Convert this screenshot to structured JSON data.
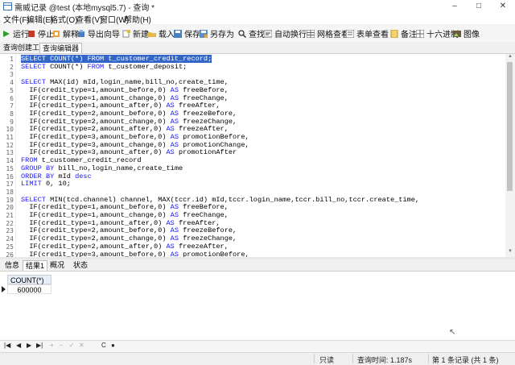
{
  "window": {
    "title": "需威记录 @test (本地mysql5.7) - 查询 *",
    "min": "–",
    "max": "□",
    "close": "✕"
  },
  "menu": [
    "文件(F)",
    "编辑(E)",
    "格式(O)",
    "查看(V)",
    "窗口(W)",
    "帮助(H)"
  ],
  "toolbar": {
    "run": "运行",
    "stop": "停止",
    "explain": "解释",
    "export": "导出向导",
    "new": "新建",
    "load": "载入",
    "save": "保存",
    "save_as": "另存为",
    "find": "查找",
    "wrap": "自动换行",
    "grid_view": "网格查看",
    "form_view": "表单查看",
    "note": "备注",
    "hex": "十六进制",
    "image": "图像"
  },
  "tabs": [
    "查询创建工具",
    "查询编辑器"
  ],
  "editor": {
    "lines": [
      "SELECT COUNT(*) FROM t_customer_credit_record;",
      "SELECT COUNT(*) FROM t_customer_deposit;",
      "",
      "SELECT MAX(id) mId,login_name,bill_no,create_time,",
      "  IF(credit_type=1,amount_before,0) AS freeBefore,",
      "  IF(credit_type=1,amount_change,0) AS freeChange,",
      "  IF(credit_type=1,amount_after,0) AS freeAfter,",
      "  IF(credit_type=2,amount_before,0) AS freezeBefore,",
      "  IF(credit_type=2,amount_change,0) AS freezeChange,",
      "  IF(credit_type=2,amount_after,0) AS freezeAfter,",
      "  IF(credit_type=3,amount_before,0) AS promotionBefore,",
      "  IF(credit_type=3,amount_change,0) AS promotionChange,",
      "  IF(credit_type=3,amount_after,0) AS promotionAfter",
      "FROM t_customer_credit_record",
      "GROUP BY bill_no,login_name,create_time",
      "ORDER BY mId desc",
      "LIMIT 0, 10;",
      "",
      "SELECT MIN(tcd.channel) channel, MAX(tccr.id) mId,tccr.login_name,tccr.bill_no,tccr.create_time,",
      "  IF(credit_type=1,amount_before,0) AS freeBefore,",
      "  IF(credit_type=1,amount_change,0) AS freeChange,",
      "  IF(credit_type=1,amount_after,0) AS freeAfter,",
      "  IF(credit_type=2,amount_before,0) AS freezeBefore,",
      "  IF(credit_type=2,amount_change,0) AS freezeChange,",
      "  IF(credit_type=2,amount_after,0) AS freezeAfter,",
      "  IF(credit_type=3,amount_before,0) AS promotionBefore,"
    ]
  },
  "result_tabs": [
    "信息",
    "结果1",
    "概况",
    "状态"
  ],
  "result": {
    "column": "COUNT(*)",
    "value": "600000"
  },
  "nav": {
    "first": "|◀",
    "prev": "◀",
    "next": "▶",
    "last": "▶|",
    "add": "+",
    "del": "−",
    "ok": "✓",
    "cancel": "✕",
    "refresh": "C",
    "stop": "●"
  },
  "status": {
    "mode": "只读",
    "time": "查询时间: 1.187s",
    "records": "第 1 条记录 (共 1 条)"
  },
  "colors": {
    "keyword": "#1a1aff",
    "selection": "#3166c8"
  }
}
